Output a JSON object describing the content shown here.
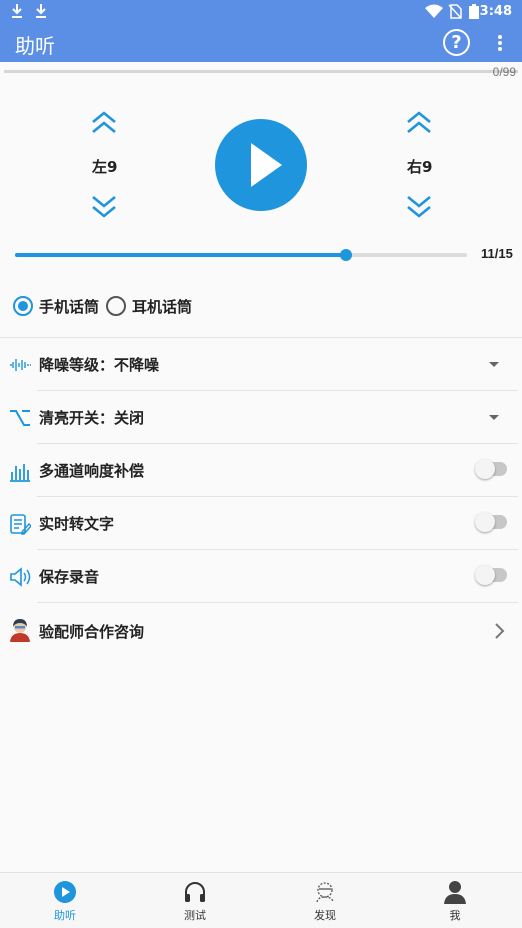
{
  "status_bar": {
    "time": "3:48"
  },
  "app_bar": {
    "title": "助听",
    "help_glyph": "?",
    "help_icon": "help-circle-icon",
    "menu_icon": "more-vert-icon"
  },
  "audio": {
    "counter": "0/99"
  },
  "volume": {
    "left_label": "左9",
    "right_label": "右9"
  },
  "slider": {
    "value_text": "11/15",
    "fraction": 0.733
  },
  "mic_options": [
    {
      "label": "手机话筒",
      "selected": true
    },
    {
      "label": "耳机话筒",
      "selected": false
    }
  ],
  "settings": [
    {
      "label": "降噪等级：不降噪",
      "icon": "waveform-icon",
      "control": "dropdown"
    },
    {
      "label": "清亮开关：关闭",
      "icon": "switch-path-icon",
      "control": "dropdown"
    },
    {
      "label": "多通道响度补偿",
      "icon": "equalizer-icon",
      "control": "toggle",
      "on": false
    },
    {
      "label": "实时转文字",
      "icon": "transcribe-icon",
      "control": "toggle",
      "on": false
    },
    {
      "label": "保存录音",
      "icon": "speaker-icon",
      "control": "toggle",
      "on": false
    },
    {
      "label": "验配师合作咨询",
      "icon": "consultant-avatar-icon",
      "control": "chevron"
    }
  ],
  "bottom_nav": [
    {
      "label": "助听",
      "icon": "play-circle-icon",
      "active": true
    },
    {
      "label": "测试",
      "icon": "headphones-icon",
      "active": false
    },
    {
      "label": "发现",
      "icon": "discover-icon",
      "active": false
    },
    {
      "label": "我",
      "icon": "person-icon",
      "active": false
    }
  ],
  "colors": {
    "app_bar": "#5b8fe6",
    "accent": "#1e95dd",
    "toggle_off": "#c7c7c7"
  }
}
